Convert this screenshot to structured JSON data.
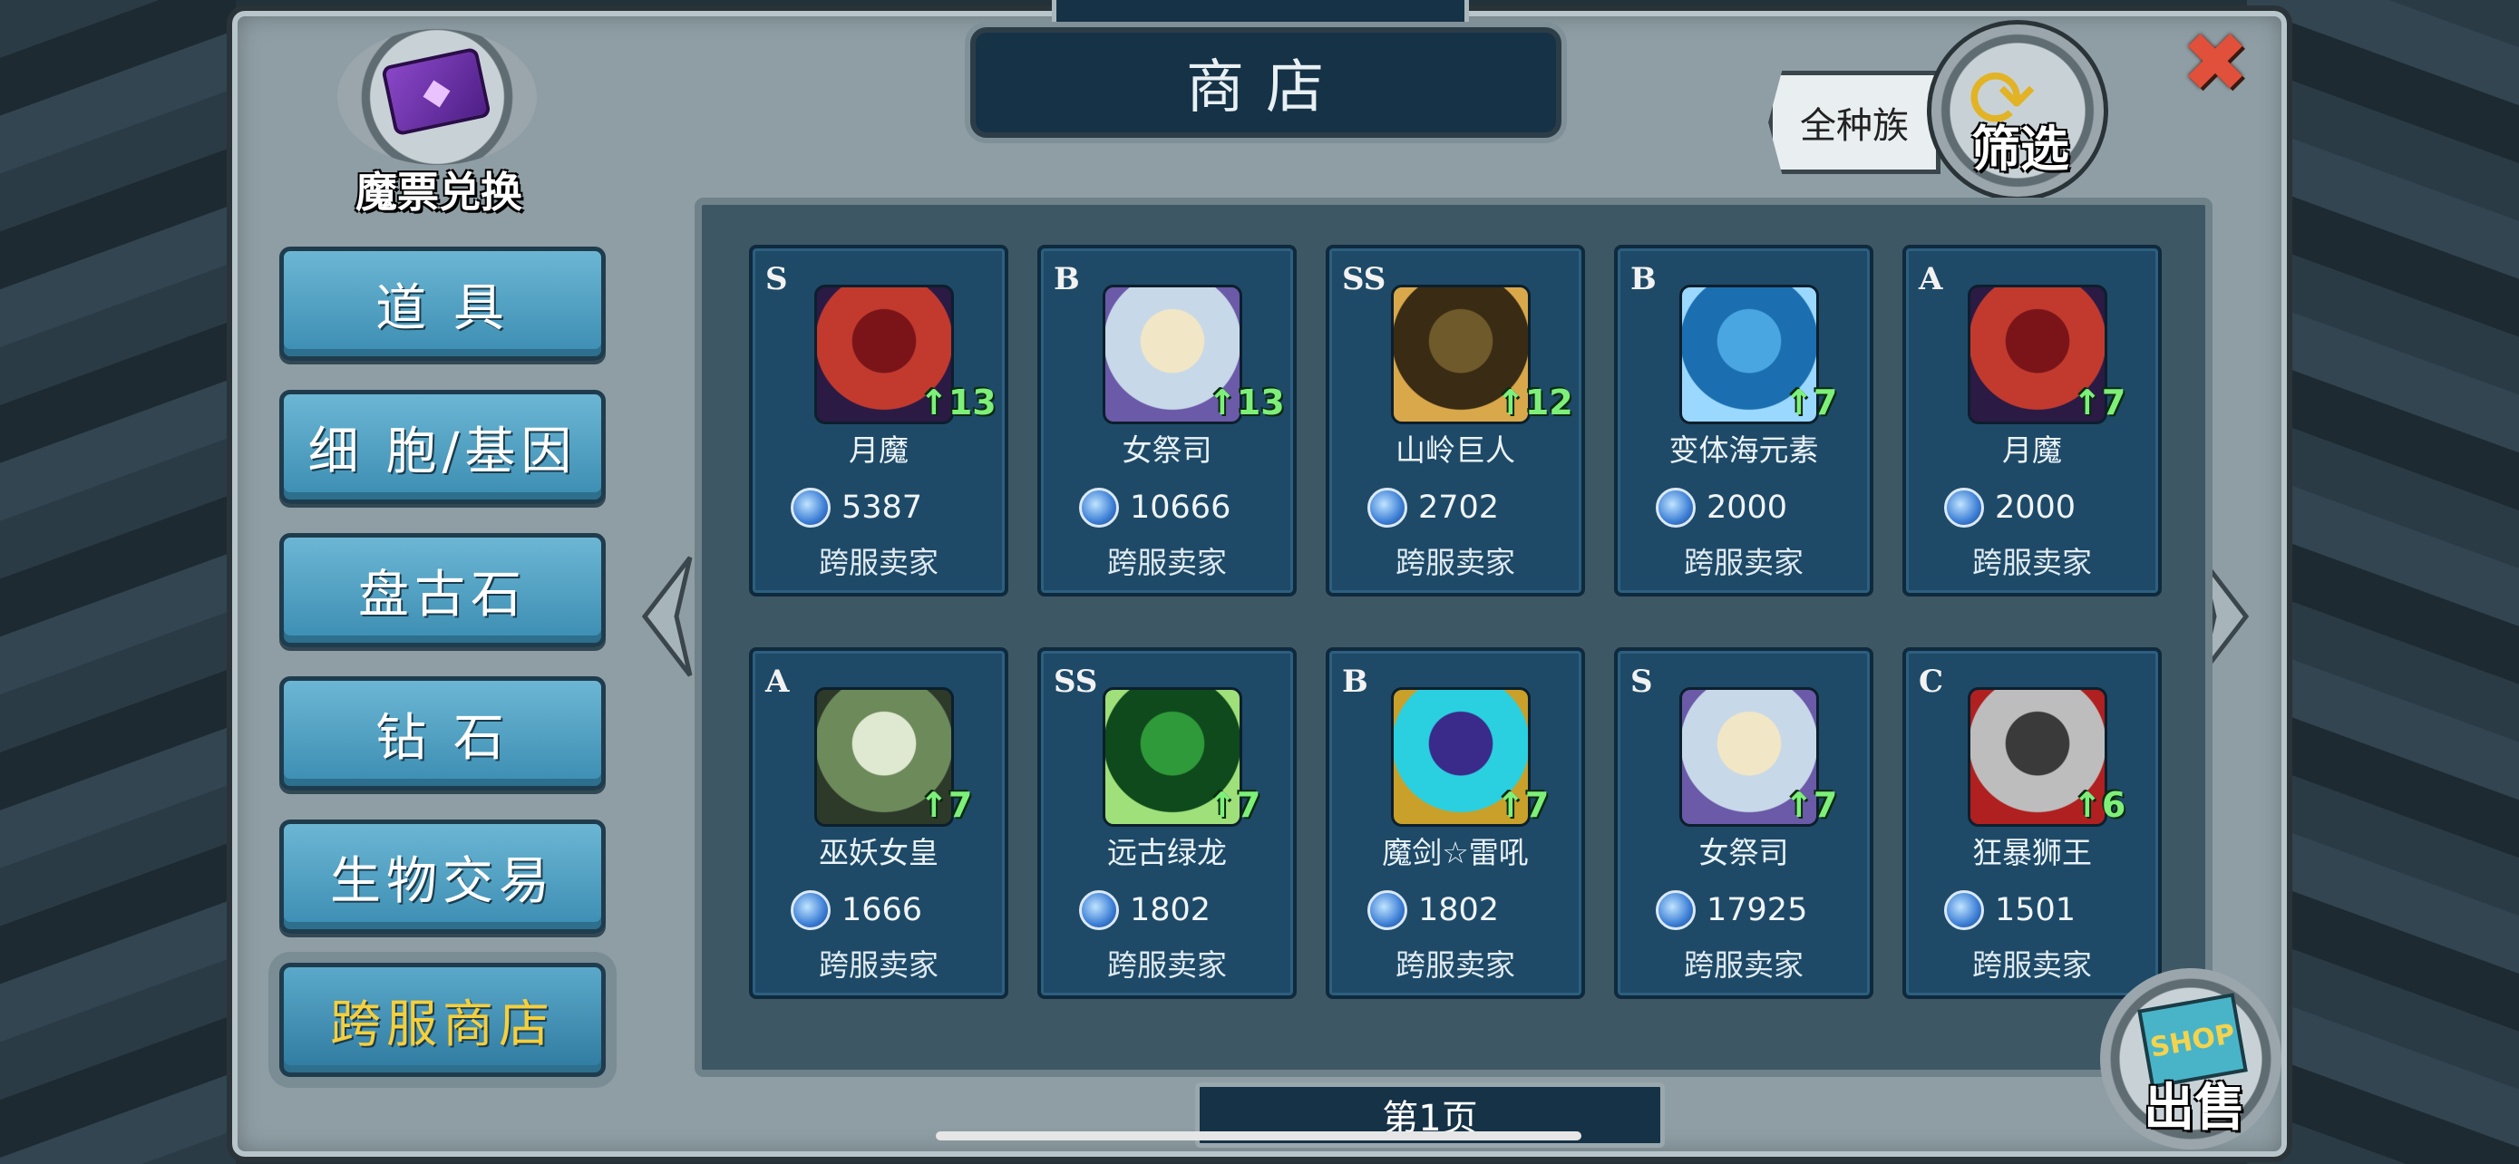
{
  "header": {
    "title": "商店"
  },
  "ticket": {
    "label": "魔票兑换"
  },
  "filter": {
    "race_label": "全种族",
    "button_label": "筛选"
  },
  "close": {
    "symbol": "✖"
  },
  "side_menu": [
    {
      "label": "道 具",
      "active": false
    },
    {
      "label": "细 胞/基因",
      "active": false
    },
    {
      "label": "盘古石",
      "active": false
    },
    {
      "label": "钻 石",
      "active": false
    },
    {
      "label": "生物交易",
      "active": false
    },
    {
      "label": "跨服商店",
      "active": true
    }
  ],
  "items": [
    {
      "grade": "S",
      "level": "↑13",
      "name": "月魔",
      "price": "5387",
      "seller": "跨服卖家",
      "colors": [
        "#7a1418",
        "#c23a2e",
        "#2a1a44"
      ]
    },
    {
      "grade": "B",
      "level": "↑13",
      "name": "女祭司",
      "price": "10666",
      "seller": "跨服卖家",
      "colors": [
        "#f1e6c6",
        "#c7d8e8",
        "#6a5aa8"
      ]
    },
    {
      "grade": "SS",
      "level": "↑12",
      "name": "山岭巨人",
      "price": "2702",
      "seller": "跨服卖家",
      "colors": [
        "#6e5a2a",
        "#3a2b14",
        "#d9a84a"
      ]
    },
    {
      "grade": "B",
      "level": "↑7",
      "name": "变体海元素",
      "price": "2000",
      "seller": "跨服卖家",
      "colors": [
        "#4aa6e0",
        "#1b6fb0",
        "#9ad8ff"
      ]
    },
    {
      "grade": "A",
      "level": "↑7",
      "name": "月魔",
      "price": "2000",
      "seller": "跨服卖家",
      "colors": [
        "#7a1418",
        "#c23a2e",
        "#2a1a44"
      ]
    },
    {
      "grade": "A",
      "level": "↑7",
      "name": "巫妖女皇",
      "price": "1666",
      "seller": "跨服卖家",
      "colors": [
        "#dfe8d0",
        "#6d8a5a",
        "#2d3a2a"
      ]
    },
    {
      "grade": "SS",
      "level": "↑7",
      "name": "远古绿龙",
      "price": "1802",
      "seller": "跨服卖家",
      "colors": [
        "#2f9a3a",
        "#0f4a1c",
        "#9fe07a"
      ]
    },
    {
      "grade": "B",
      "level": "↑7",
      "name": "魔剑☆雷吼",
      "price": "1802",
      "seller": "跨服卖家",
      "colors": [
        "#3a2a8a",
        "#2ad0e0",
        "#c8a02a"
      ]
    },
    {
      "grade": "S",
      "level": "↑7",
      "name": "女祭司",
      "price": "17925",
      "seller": "跨服卖家",
      "colors": [
        "#f1e6c6",
        "#c7d8e8",
        "#6a5aa8"
      ]
    },
    {
      "grade": "C",
      "level": "↑6",
      "name": "狂暴狮王",
      "price": "1501",
      "seller": "跨服卖家",
      "colors": [
        "#3a3a3a",
        "#bdbdbd",
        "#b02020"
      ]
    }
  ],
  "pagination": {
    "label": "第1页"
  },
  "sell": {
    "sign": "SHOP",
    "label": "出售"
  }
}
